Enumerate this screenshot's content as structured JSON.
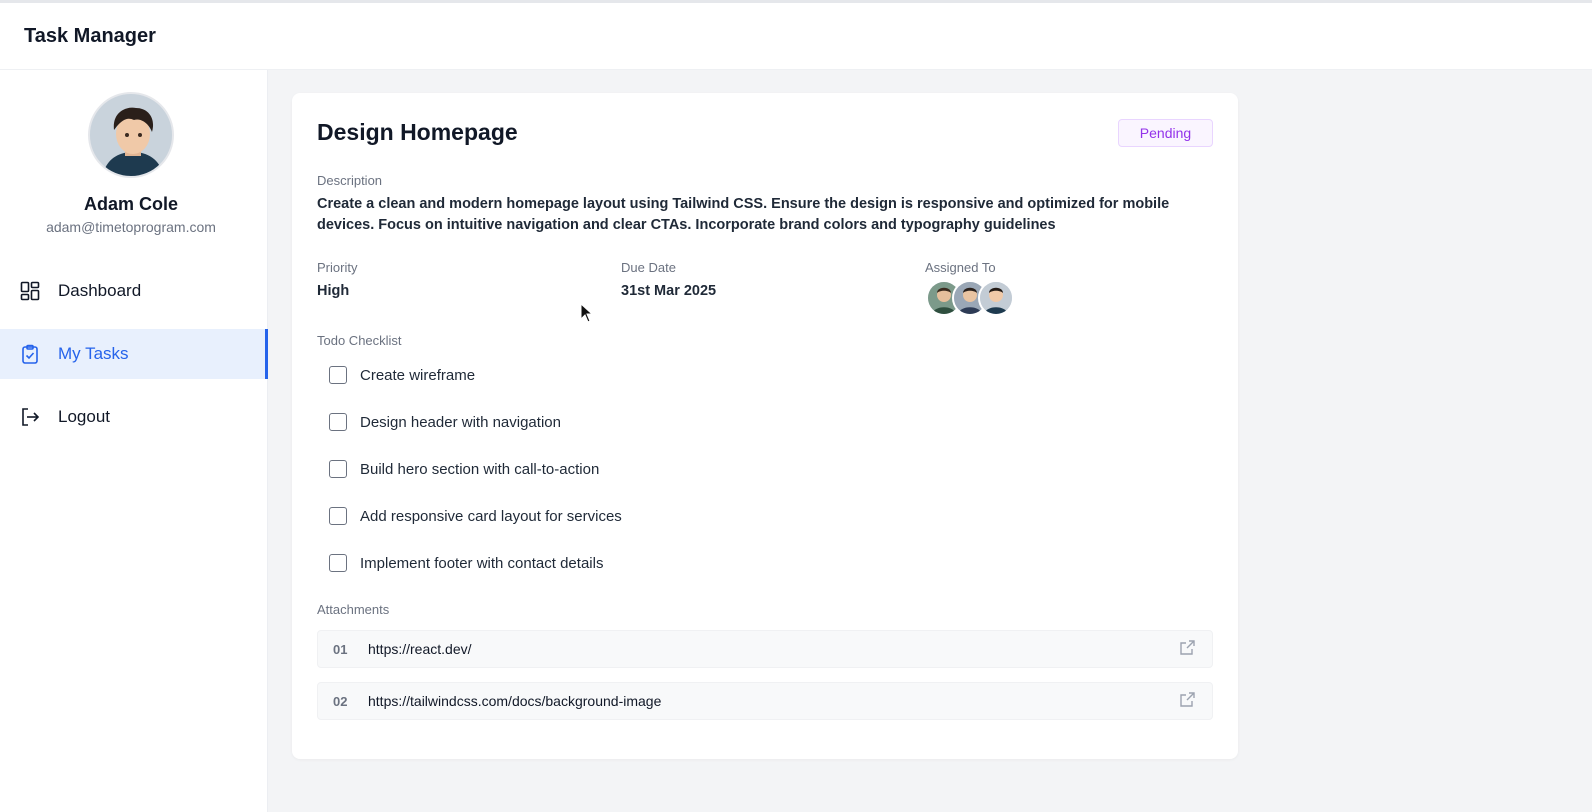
{
  "app": {
    "title": "Task Manager"
  },
  "user": {
    "name": "Adam Cole",
    "email": "adam@timetoprogram.com",
    "avatar_icon": "user-avatar"
  },
  "sidebar": {
    "items": [
      {
        "label": "Dashboard",
        "icon": "dashboard-grid-icon"
      },
      {
        "label": "My Tasks",
        "icon": "clipboard-check-icon",
        "active": true
      },
      {
        "label": "Logout",
        "icon": "logout-icon"
      }
    ]
  },
  "task": {
    "title": "Design Homepage",
    "status": "Pending",
    "description_label": "Description",
    "description": "Create a clean and modern homepage layout using Tailwind CSS. Ensure the design is responsive and optimized for mobile devices. Focus on intuitive navigation and clear CTAs. Incorporate brand colors and typography guidelines",
    "priority_label": "Priority",
    "priority": "High",
    "due_date_label": "Due Date",
    "due_date": "31st Mar 2025",
    "assigned_label": "Assigned To",
    "assignee_count": 3,
    "checklist_label": "Todo Checklist",
    "checklist": [
      {
        "text": "Create wireframe",
        "checked": false
      },
      {
        "text": "Design header with navigation",
        "checked": false
      },
      {
        "text": "Build hero section with call-to-action",
        "checked": false
      },
      {
        "text": "Add responsive card layout for services",
        "checked": false
      },
      {
        "text": "Implement footer with contact details",
        "checked": false
      }
    ],
    "attachments_label": "Attachments",
    "attachments": [
      {
        "num": "01",
        "url": "https://react.dev/"
      },
      {
        "num": "02",
        "url": "https://tailwindcss.com/docs/background-image"
      }
    ]
  },
  "colors": {
    "accent": "#2563eb",
    "status_pending": "#9333ea",
    "status_pending_bg": "#faf5ff"
  }
}
